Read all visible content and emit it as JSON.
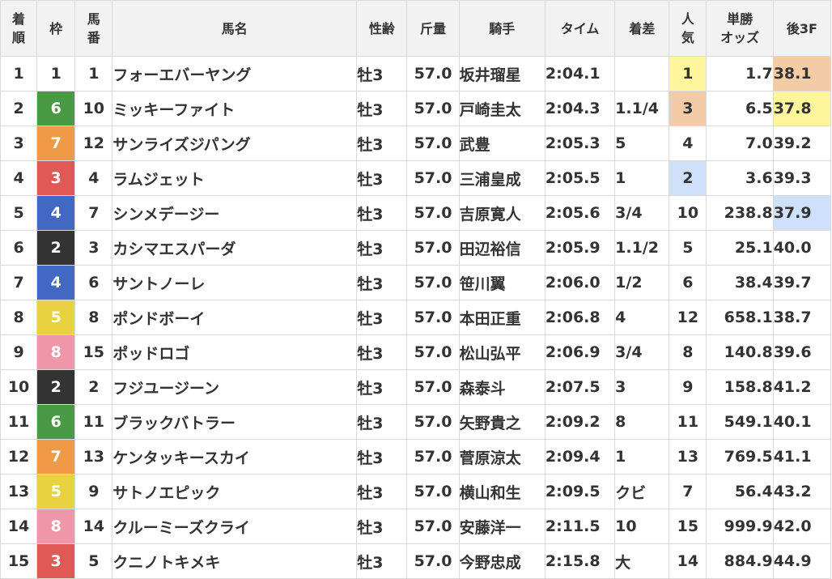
{
  "headers": {
    "rank": [
      "着",
      "順"
    ],
    "waku": "枠",
    "umaban": [
      "馬",
      "番"
    ],
    "horse": "馬名",
    "sexage": "性齢",
    "weight": "斤量",
    "jockey": "騎手",
    "time": "タイム",
    "margin": "着差",
    "popularity": [
      "人",
      "気"
    ],
    "odds": [
      "単勝",
      "オッズ"
    ],
    "last3f": "後3F"
  },
  "waku_colors": {
    "1": {
      "bg": "#ffffff",
      "fg": "#333333"
    },
    "2": {
      "bg": "#333333",
      "fg": "#ffffff"
    },
    "3": {
      "bg": "#e05a55",
      "fg": "#ffffff"
    },
    "4": {
      "bg": "#4169c4",
      "fg": "#ffffff"
    },
    "5": {
      "bg": "#e8d23f",
      "fg": "#ffffff"
    },
    "6": {
      "bg": "#4a9a45",
      "fg": "#ffffff"
    },
    "7": {
      "bg": "#ef9a46",
      "fg": "#ffffff"
    },
    "8": {
      "bg": "#ef97a9",
      "fg": "#ffffff"
    }
  },
  "rows": [
    {
      "rank": "1",
      "waku": "1",
      "umaban": "1",
      "horse": "フォーエバーヤング",
      "sexage": "牡3",
      "weight": "57.0",
      "jockey": "坂井瑠星",
      "time": "2:04.1",
      "margin": "",
      "popularity": "1",
      "odds": "1.7",
      "last3f": "38.1",
      "pop_hl": "pop1",
      "odds_hl": true,
      "f3_hl": "f3-3"
    },
    {
      "rank": "2",
      "waku": "6",
      "umaban": "10",
      "horse": "ミッキーファイト",
      "sexage": "牡3",
      "weight": "57.0",
      "jockey": "戸崎圭太",
      "time": "2:04.3",
      "margin": "1.1/4",
      "popularity": "3",
      "odds": "6.5",
      "last3f": "37.8",
      "pop_hl": "pop3",
      "odds_hl": true,
      "f3_hl": "f3-1"
    },
    {
      "rank": "3",
      "waku": "7",
      "umaban": "12",
      "horse": "サンライズジパング",
      "sexage": "牡3",
      "weight": "57.0",
      "jockey": "武豊",
      "time": "2:05.3",
      "margin": "5",
      "popularity": "4",
      "odds": "7.0",
      "last3f": "39.2",
      "pop_hl": "",
      "odds_hl": true,
      "f3_hl": ""
    },
    {
      "rank": "4",
      "waku": "3",
      "umaban": "4",
      "horse": "ラムジェット",
      "sexage": "牡3",
      "weight": "57.0",
      "jockey": "三浦皇成",
      "time": "2:05.5",
      "margin": "1",
      "popularity": "2",
      "odds": "3.6",
      "last3f": "39.3",
      "pop_hl": "pop2",
      "odds_hl": true,
      "f3_hl": ""
    },
    {
      "rank": "5",
      "waku": "4",
      "umaban": "7",
      "horse": "シンメデージー",
      "sexage": "牡3",
      "weight": "57.0",
      "jockey": "吉原寛人",
      "time": "2:05.6",
      "margin": "3/4",
      "popularity": "10",
      "odds": "238.8",
      "last3f": "37.9",
      "pop_hl": "",
      "odds_hl": false,
      "f3_hl": "f3-2"
    },
    {
      "rank": "6",
      "waku": "2",
      "umaban": "3",
      "horse": "カシマエスパーダ",
      "sexage": "牡3",
      "weight": "57.0",
      "jockey": "田辺裕信",
      "time": "2:05.9",
      "margin": "1.1/2",
      "popularity": "5",
      "odds": "25.1",
      "last3f": "40.0",
      "pop_hl": "",
      "odds_hl": false,
      "f3_hl": ""
    },
    {
      "rank": "7",
      "waku": "4",
      "umaban": "6",
      "horse": "サントノーレ",
      "sexage": "牡3",
      "weight": "57.0",
      "jockey": "笹川翼",
      "time": "2:06.0",
      "margin": "1/2",
      "popularity": "6",
      "odds": "38.4",
      "last3f": "39.7",
      "pop_hl": "",
      "odds_hl": false,
      "f3_hl": ""
    },
    {
      "rank": "8",
      "waku": "5",
      "umaban": "8",
      "horse": "ポンドボーイ",
      "sexage": "牡3",
      "weight": "57.0",
      "jockey": "本田正重",
      "time": "2:06.8",
      "margin": "4",
      "popularity": "12",
      "odds": "658.1",
      "last3f": "38.7",
      "pop_hl": "",
      "odds_hl": false,
      "f3_hl": ""
    },
    {
      "rank": "9",
      "waku": "8",
      "umaban": "15",
      "horse": "ポッドロゴ",
      "sexage": "牡3",
      "weight": "57.0",
      "jockey": "松山弘平",
      "time": "2:06.9",
      "margin": "3/4",
      "popularity": "8",
      "odds": "140.8",
      "last3f": "39.6",
      "pop_hl": "",
      "odds_hl": false,
      "f3_hl": ""
    },
    {
      "rank": "10",
      "waku": "2",
      "umaban": "2",
      "horse": "フジユージーン",
      "sexage": "牡3",
      "weight": "57.0",
      "jockey": "森泰斗",
      "time": "2:07.5",
      "margin": "3",
      "popularity": "9",
      "odds": "158.8",
      "last3f": "41.2",
      "pop_hl": "",
      "odds_hl": false,
      "f3_hl": ""
    },
    {
      "rank": "11",
      "waku": "6",
      "umaban": "11",
      "horse": "ブラックバトラー",
      "sexage": "牡3",
      "weight": "57.0",
      "jockey": "矢野貴之",
      "time": "2:09.2",
      "margin": "8",
      "popularity": "11",
      "odds": "549.1",
      "last3f": "40.1",
      "pop_hl": "",
      "odds_hl": false,
      "f3_hl": ""
    },
    {
      "rank": "12",
      "waku": "7",
      "umaban": "13",
      "horse": "ケンタッキースカイ",
      "sexage": "牡3",
      "weight": "57.0",
      "jockey": "菅原涼太",
      "time": "2:09.4",
      "margin": "1",
      "popularity": "13",
      "odds": "769.5",
      "last3f": "41.1",
      "pop_hl": "",
      "odds_hl": false,
      "f3_hl": ""
    },
    {
      "rank": "13",
      "waku": "5",
      "umaban": "9",
      "horse": "サトノエピック",
      "sexage": "牡3",
      "weight": "57.0",
      "jockey": "横山和生",
      "time": "2:09.5",
      "margin": "クビ",
      "popularity": "7",
      "odds": "56.4",
      "last3f": "43.2",
      "pop_hl": "",
      "odds_hl": false,
      "f3_hl": ""
    },
    {
      "rank": "14",
      "waku": "8",
      "umaban": "14",
      "horse": "クルーミーズクライ",
      "sexage": "牡3",
      "weight": "57.0",
      "jockey": "安藤洋一",
      "time": "2:11.5",
      "margin": "10",
      "popularity": "15",
      "odds": "999.9",
      "last3f": "42.0",
      "pop_hl": "",
      "odds_hl": false,
      "f3_hl": ""
    },
    {
      "rank": "15",
      "waku": "3",
      "umaban": "5",
      "horse": "クニノトキメキ",
      "sexage": "牡3",
      "weight": "57.0",
      "jockey": "今野忠成",
      "time": "2:15.8",
      "margin": "大",
      "popularity": "14",
      "odds": "884.9",
      "last3f": "44.9",
      "pop_hl": "",
      "odds_hl": false,
      "f3_hl": ""
    }
  ]
}
